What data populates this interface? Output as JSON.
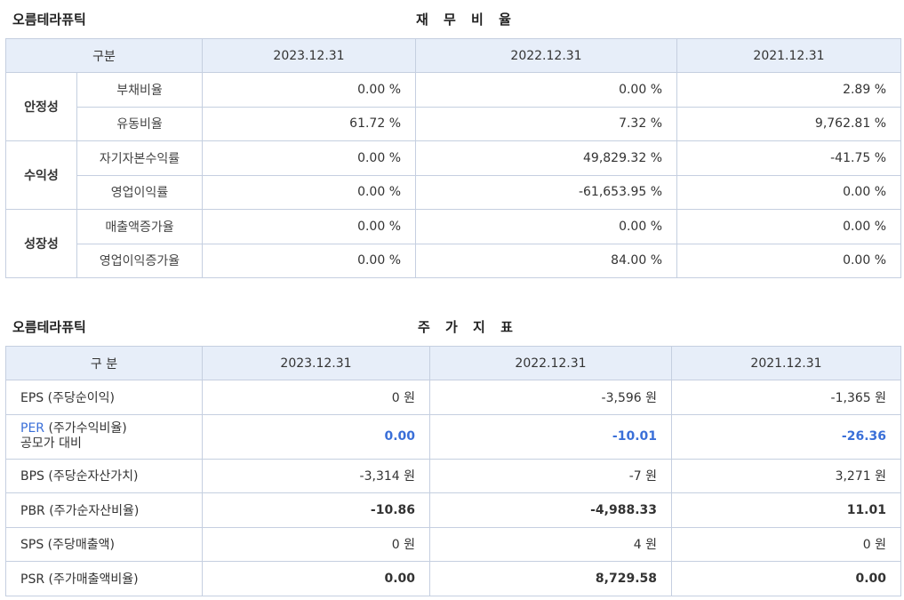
{
  "financial_ratios": {
    "company": "오름테라퓨틱",
    "title": "재 무 비 율",
    "headers": [
      "구분",
      "2023.12.31",
      "2022.12.31",
      "2021.12.31"
    ],
    "groups": [
      {
        "name": "안정성",
        "rows": [
          {
            "label": "부채비율",
            "values": [
              "0.00 %",
              "0.00 %",
              "2.89 %"
            ]
          },
          {
            "label": "유동비율",
            "values": [
              "61.72 %",
              "7.32 %",
              "9,762.81 %"
            ]
          }
        ]
      },
      {
        "name": "수익성",
        "rows": [
          {
            "label": "자기자본수익률",
            "values": [
              "0.00 %",
              "49,829.32 %",
              "-41.75 %"
            ]
          },
          {
            "label": "영업이익률",
            "values": [
              "0.00 %",
              "-61,653.95 %",
              "0.00 %"
            ]
          }
        ]
      },
      {
        "name": "성장성",
        "rows": [
          {
            "label": "매출액증가율",
            "values": [
              "0.00 %",
              "0.00 %",
              "0.00 %"
            ]
          },
          {
            "label": "영업이익증가율",
            "values": [
              "0.00 %",
              "84.00 %",
              "0.00 %"
            ]
          }
        ]
      }
    ]
  },
  "stock_indicators": {
    "company": "오름테라퓨틱",
    "title": "주 가 지 표",
    "headers": [
      "구 분",
      "2023.12.31",
      "2022.12.31",
      "2021.12.31"
    ],
    "rows": [
      {
        "label": "EPS (주당순이익)",
        "values": [
          "0 원",
          "-3,596 원",
          "-1,365 원"
        ]
      },
      {
        "label_main": "PER",
        "label_rest": " (주가수익비율)",
        "label_sub": "공모가 대비",
        "values": [
          "0.00",
          "-10.01",
          "-26.36"
        ]
      },
      {
        "label": "BPS (주당순자산가치)",
        "values": [
          "-3,314 원",
          "-7 원",
          "3,271 원"
        ]
      },
      {
        "label": "PBR (주가순자산비율)",
        "values": [
          "-10.86",
          "-4,988.33",
          "11.01"
        ]
      },
      {
        "label": "SPS (주당매출액)",
        "values": [
          "0 원",
          "4 원",
          "0 원"
        ]
      },
      {
        "label": "PSR (주가매출액비율)",
        "values": [
          "0.00",
          "8,729.58",
          "0.00"
        ]
      }
    ]
  },
  "colors": {
    "header_bg": "#e7eef9",
    "border": "#c5cfe0",
    "accent_blue": "#3a6fd8"
  }
}
